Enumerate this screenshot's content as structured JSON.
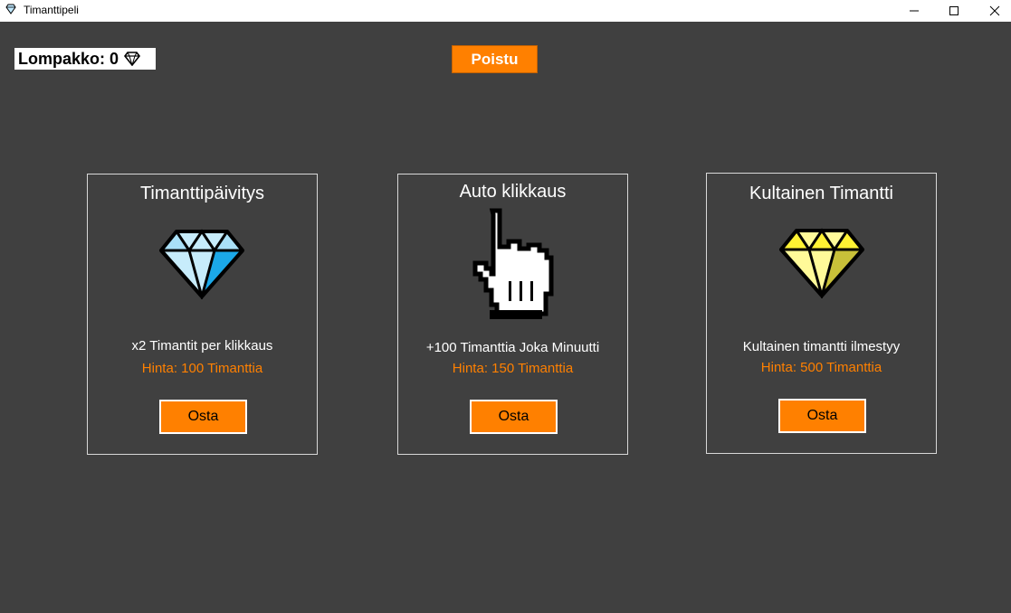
{
  "window": {
    "title": "Timanttipeli",
    "app_icon": "diamond-icon",
    "controls": [
      "minimize-icon",
      "maximize-icon",
      "close-icon"
    ]
  },
  "wallet": {
    "label": "Lompakko: 0",
    "icon": "diamond-icon"
  },
  "exit_button": {
    "label": "Poistu"
  },
  "colors": {
    "background": "#404040",
    "accent": "#ff8000",
    "text": "#ffffff",
    "card_border": "#d8d8d8"
  },
  "shop": {
    "items": [
      {
        "title": "Timanttipäivitys",
        "icon": "blue-diamond-icon",
        "description": "x2 Timantit per klikkaus",
        "price": "Hinta: 100 Timanttia",
        "button": "Osta"
      },
      {
        "title": "Auto klikkaus",
        "icon": "pointer-hand-icon",
        "description": "+100 Timanttia Joka Minuutti",
        "price": "Hinta: 150 Timanttia",
        "button": "Osta"
      },
      {
        "title": "Kultainen Timantti",
        "icon": "gold-diamond-icon",
        "description": "Kultainen timantti ilmestyy",
        "price": "Hinta: 500 Timanttia",
        "button": "Osta"
      }
    ]
  }
}
